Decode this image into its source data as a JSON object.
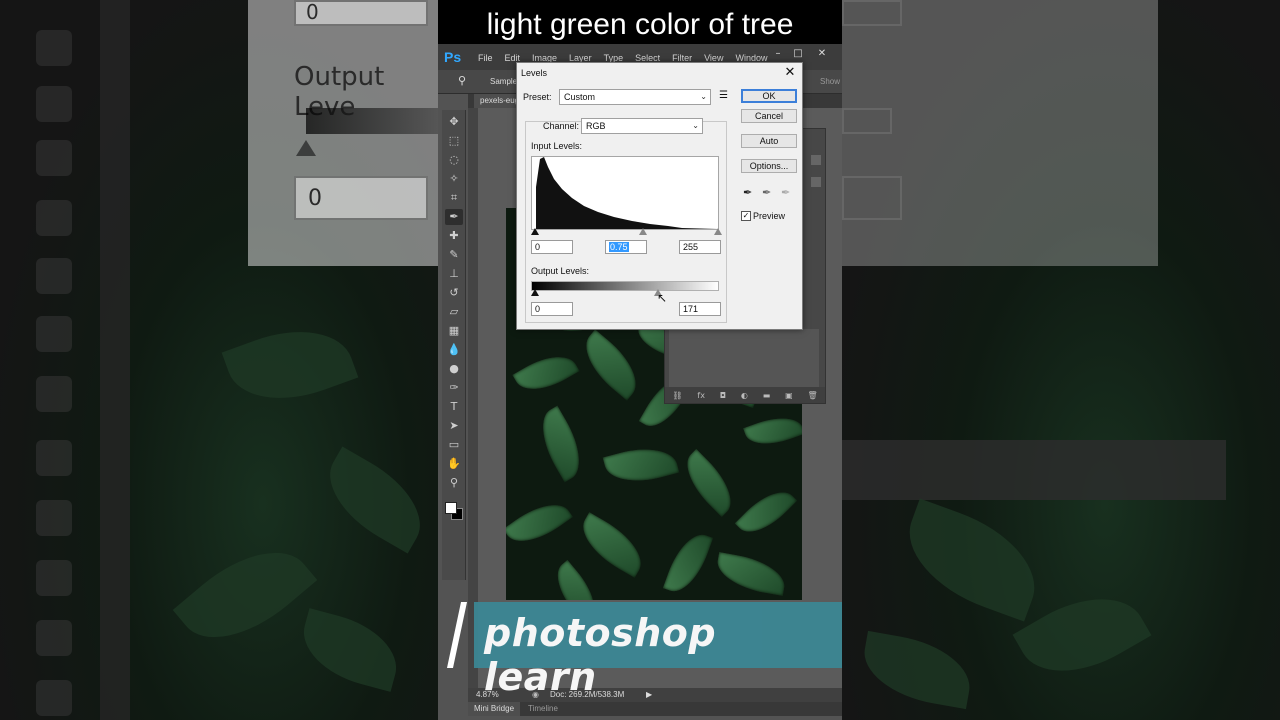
{
  "video": {
    "caption": "light green color of tree",
    "banner": "photoshop learn"
  },
  "photoshop": {
    "logo": "Ps",
    "menu": [
      "File",
      "Edit",
      "Image",
      "Layer",
      "Type",
      "Select",
      "Filter",
      "View",
      "Window"
    ],
    "options_label": "Sample",
    "options_right": "Show",
    "doc_tab": "pexels-eug",
    "status": {
      "zoom": "4.87%",
      "doc": "Doc: 269.2M/538.3M"
    },
    "bottom_tabs": [
      "Mini Bridge",
      "Timeline"
    ],
    "tool_icons": [
      "move-icon",
      "marquee-icon",
      "lasso-icon",
      "quick-select-icon",
      "crop-icon",
      "eyedropper-icon",
      "healing-icon",
      "brush-icon",
      "stamp-icon",
      "history-brush-icon",
      "eraser-icon",
      "gradient-icon",
      "blur-icon",
      "dodge-icon",
      "pen-icon",
      "type-icon",
      "path-select-icon",
      "shape-icon",
      "hand-icon",
      "zoom-icon"
    ]
  },
  "levels_dialog": {
    "title": "Levels",
    "preset_label": "Preset:",
    "preset_value": "Custom",
    "channel_label": "Channel:",
    "channel_value": "RGB",
    "input_levels_label": "Input Levels:",
    "input_black": "0",
    "input_gamma": "0.75",
    "input_white": "255",
    "output_levels_label": "Output Levels:",
    "output_black": "0",
    "output_white": "171",
    "buttons": {
      "ok": "OK",
      "cancel": "Cancel",
      "auto": "Auto",
      "options": "Options..."
    },
    "preview_label": "Preview",
    "preview_checked": true
  },
  "backdrop": {
    "output_label": "Output Leve",
    "value_top": "0",
    "value_bottom": "0"
  }
}
